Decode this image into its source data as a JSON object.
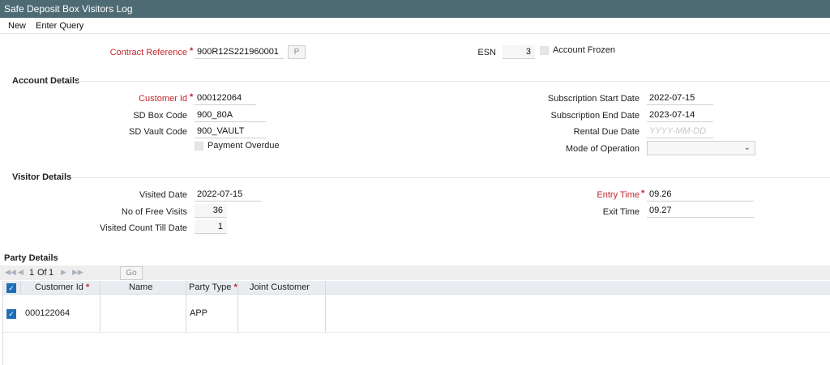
{
  "window": {
    "title": "Safe Deposit Box Visitors Log"
  },
  "menu": {
    "new": "New",
    "enter_query": "Enter Query"
  },
  "header": {
    "contract_reference_label": "Contract Reference",
    "contract_reference_value": "900R12S221960001",
    "p_button": "P",
    "esn_label": "ESN",
    "esn_value": "3",
    "account_frozen_label": "Account Frozen"
  },
  "account_details": {
    "title": "Account Details",
    "customer_id_label": "Customer Id",
    "customer_id_value": "000122064",
    "sd_box_code_label": "SD Box Code",
    "sd_box_code_value": "900_80A",
    "sd_vault_code_label": "SD Vault Code",
    "sd_vault_code_value": "900_VAULT",
    "payment_overdue_label": "Payment Overdue",
    "subscription_start_label": "Subscription Start Date",
    "subscription_start_value": "2022-07-15",
    "subscription_end_label": "Subscription End Date",
    "subscription_end_value": "2023-07-14",
    "rental_due_label": "Rental Due Date",
    "rental_due_placeholder": "YYYY-MM-DD",
    "mode_of_operation_label": "Mode of Operation",
    "mode_of_operation_value": ""
  },
  "visitor_details": {
    "title": "Visitor Details",
    "visited_date_label": "Visited Date",
    "visited_date_value": "2022-07-15",
    "free_visits_label": "No of Free Visits",
    "free_visits_value": "36",
    "visited_count_label": "Visited Count Till Date",
    "visited_count_value": "1",
    "entry_time_label": "Entry Time",
    "entry_time_value": "09.26",
    "exit_time_label": "Exit Time",
    "exit_time_value": "09.27"
  },
  "party_details": {
    "title": "Party Details",
    "pager": {
      "current": "1",
      "of_label": "Of",
      "total": "1"
    },
    "go_label": "Go",
    "columns": {
      "customer_id": "Customer Id",
      "name": "Name",
      "party_type": "Party Type",
      "joint_customer": "Joint Customer"
    },
    "rows": [
      {
        "customer_id": "000122064",
        "name": "",
        "party_type": "APP",
        "joint_customer": ""
      }
    ]
  }
}
